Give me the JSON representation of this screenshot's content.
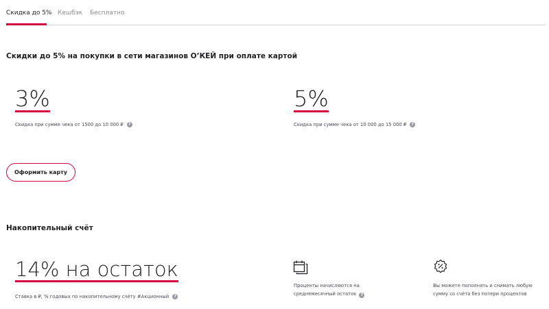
{
  "tabs": [
    {
      "label": "Скидка до 5%",
      "active": true
    },
    {
      "label": "Кешбэк",
      "active": false
    },
    {
      "label": "Бесплатно",
      "active": false
    }
  ],
  "discount": {
    "title": "Скидки до 5% на покупки в сети магазинов О’КЕЙ при оплате картой",
    "tiers": [
      {
        "value": "3%",
        "note": "Скидка при сумме чека от 1500 до 10 000 ₽"
      },
      {
        "value": "5%",
        "note": "Скидка при сумме чека от 10 000 до 15 000 ₽"
      }
    ],
    "cta_label": "Оформить карту"
  },
  "savings": {
    "title": "Накопительный счёт",
    "rate": "14% на остаток",
    "rate_note": "Ставка в ₽, % годовых по накопительному счёту #Акционный",
    "features": [
      {
        "icon": "calendar-icon",
        "line1": "Проценты начисляются на",
        "line2": "среднемесячный остаток",
        "has_help": true
      },
      {
        "icon": "percent-badge-icon",
        "line1": "Вы можете пополнять и снимать любую",
        "line2": "сумму со счёта без потери процентов",
        "has_help": false
      }
    ]
  },
  "help_glyph": "?",
  "colors": {
    "accent": "#d6003f",
    "text": "#1f1f24",
    "muted": "#8a8a93"
  }
}
